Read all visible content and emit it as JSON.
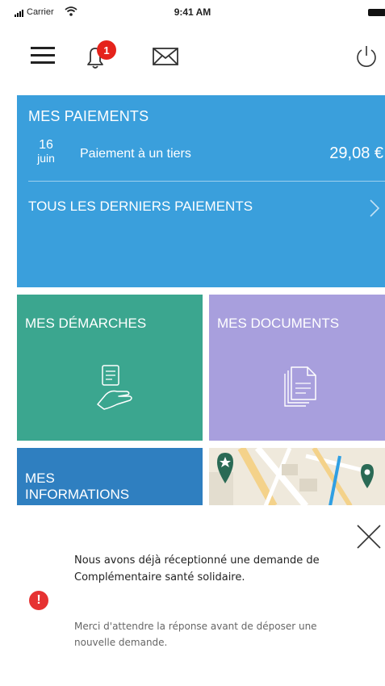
{
  "status_bar": {
    "carrier": "Carrier",
    "time": "9:41 AM"
  },
  "toolbar": {
    "icons": [
      "menu-icon",
      "bell-icon",
      "mail-icon",
      "power-icon"
    ],
    "notification_count": "1",
    "badge_color": "#e5231b"
  },
  "payments": {
    "title": "MES PAIEMENTS",
    "last": {
      "day": "16",
      "month": "juin",
      "label": "Paiement à un tiers",
      "amount": "29,08 €"
    },
    "all_label": "TOUS LES DERNIERS PAIEMENTS",
    "color": "#3a9fdc"
  },
  "tiles": {
    "demarches": {
      "label": "MES DÉMARCHES",
      "icon": "hand-document-icon",
      "color": "#3ba68f"
    },
    "documents": {
      "label": "MES DOCUMENTS",
      "icon": "documents-icon",
      "color": "#a89fdd"
    },
    "informations": {
      "label_line1": "MES",
      "label_line2": "INFORMATIONS",
      "color": "#2f7fc0"
    },
    "map": {
      "icon": "map-icon"
    }
  },
  "popup": {
    "message": "Nous avons déjà réceptionné une demande de Complémentaire santé solidaire.",
    "submessage": "Merci d'attendre la réponse avant de déposer une nouvelle demande.",
    "alert_color": "#e63232",
    "icons": [
      "close-icon",
      "alert-icon"
    ]
  }
}
